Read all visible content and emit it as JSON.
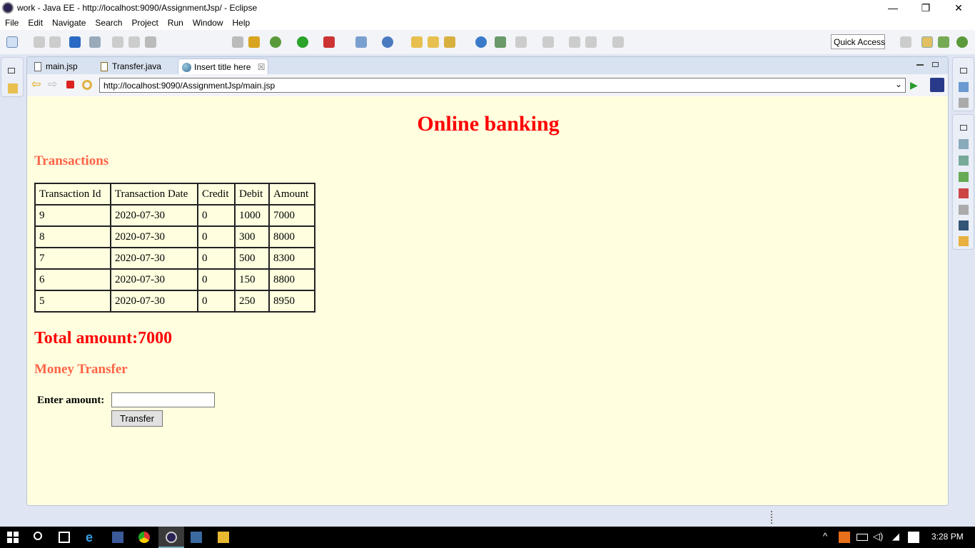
{
  "window": {
    "title": "work - Java EE - http://localhost:9090/AssignmentJsp/ - Eclipse",
    "minimize": "—",
    "maximize": "❐",
    "close": "✕"
  },
  "menu": [
    "File",
    "Edit",
    "Navigate",
    "Search",
    "Project",
    "Run",
    "Window",
    "Help"
  ],
  "toolbar": {
    "quick_access": "Quick Access"
  },
  "tabs": [
    {
      "label": "main.jsp"
    },
    {
      "label": "Transfer.java"
    },
    {
      "label": "Insert title here",
      "close": "☒"
    }
  ],
  "browser": {
    "url": "http://localhost:9090/AssignmentJsp/main.jsp",
    "dropdown": "⌄",
    "go": "▶"
  },
  "page": {
    "heading": "Online banking",
    "transactions_heading": "Transactions",
    "table": {
      "headers": [
        "Transaction Id",
        "Transaction Date",
        "Credit",
        "Debit",
        "Amount"
      ],
      "rows": [
        [
          "9",
          "2020-07-30",
          "0",
          "1000",
          "7000"
        ],
        [
          "8",
          "2020-07-30",
          "0",
          "300",
          "8000"
        ],
        [
          "7",
          "2020-07-30",
          "0",
          "500",
          "8300"
        ],
        [
          "6",
          "2020-07-30",
          "0",
          "150",
          "8800"
        ],
        [
          "5",
          "2020-07-30",
          "0",
          "250",
          "8950"
        ]
      ]
    },
    "total": "Total amount:7000",
    "transfer_heading": "Money Transfer",
    "amount_label": "Enter amount:",
    "amount_value": "",
    "transfer_button": "Transfer"
  },
  "taskbar": {
    "time": "3:28 PM"
  },
  "colors": {
    "page_bg": "#ffffe0",
    "heading": "#ff0000",
    "subheading": "#ff6347"
  }
}
